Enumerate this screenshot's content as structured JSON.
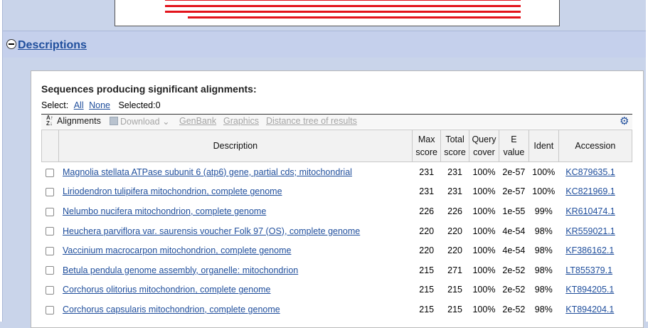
{
  "section": {
    "title": "Descriptions"
  },
  "panel": {
    "title": "Sequences producing significant alignments:",
    "select_label": "Select:",
    "select_all": "All",
    "select_none": "None",
    "selected": "Selected:0"
  },
  "toolbar": {
    "alignments": "Alignments",
    "download": "Download",
    "genbank": "GenBank",
    "graphics": "Graphics",
    "distance_tree": "Distance tree of results"
  },
  "table": {
    "headers": {
      "description": "Description",
      "max_score_1": "Max",
      "max_score_2": "score",
      "total_score_1": "Total",
      "total_score_2": "score",
      "query_cover_1": "Query",
      "query_cover_2": "cover",
      "evalue_1": "E",
      "evalue_2": "value",
      "ident": "Ident",
      "accession": "Accession"
    },
    "rows": [
      {
        "description": "Magnolia stellata ATPase subunit 6 (atp6) gene, partial cds; mitochondrial",
        "max": "231",
        "total": "231",
        "cover": "100%",
        "evalue": "2e-57",
        "ident": "100%",
        "accession": "KC879635.1"
      },
      {
        "description": "Liriodendron tulipifera mitochondrion, complete genome",
        "max": "231",
        "total": "231",
        "cover": "100%",
        "evalue": "2e-57",
        "ident": "100%",
        "accession": "KC821969.1"
      },
      {
        "description": "Nelumbo nucifera mitochondrion, complete genome",
        "max": "226",
        "total": "226",
        "cover": "100%",
        "evalue": "1e-55",
        "ident": "99%",
        "accession": "KR610474.1"
      },
      {
        "description": "Heuchera parviflora var. saurensis voucher Folk 97 (OS), complete genome",
        "max": "220",
        "total": "220",
        "cover": "100%",
        "evalue": "4e-54",
        "ident": "98%",
        "accession": "KR559021.1"
      },
      {
        "description": "Vaccinium macrocarpon mitochondrion, complete genome",
        "max": "220",
        "total": "220",
        "cover": "100%",
        "evalue": "4e-54",
        "ident": "98%",
        "accession": "KF386162.1"
      },
      {
        "description": "Betula pendula genome assembly, organelle: mitochondrion",
        "max": "215",
        "total": "271",
        "cover": "100%",
        "evalue": "2e-52",
        "ident": "98%",
        "accession": "LT855379.1"
      },
      {
        "description": "Corchorus olitorius mitochondrion, complete genome",
        "max": "215",
        "total": "215",
        "cover": "100%",
        "evalue": "2e-52",
        "ident": "98%",
        "accession": "KT894205.1"
      },
      {
        "description": "Corchorus capsularis mitochondrion, complete genome",
        "max": "215",
        "total": "215",
        "cover": "100%",
        "evalue": "2e-52",
        "ident": "98%",
        "accession": "KT894204.1"
      }
    ]
  },
  "colors": {
    "link": "#1f4e9c",
    "hit_line": "#e3131b",
    "section_bg": "#c5d0ec"
  },
  "icons": {
    "toggle": "collapse-minus-icon",
    "settings": "gear-icon",
    "sort": "sort-icon",
    "download": "floppy-disk-icon"
  }
}
